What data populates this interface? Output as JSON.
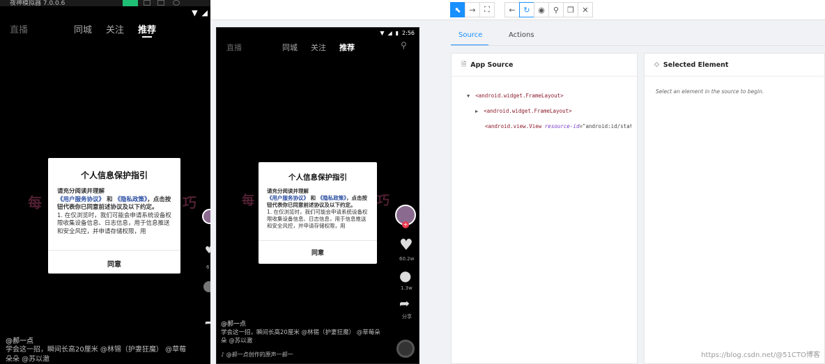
{
  "emulator_left": {
    "title": "夜神模拟器 7.0.0.6",
    "status_icons": [
      "wifi-icon",
      "signal-icon"
    ],
    "nav": {
      "logo": "直播",
      "tab_local": "同城",
      "tab_follow": "关注",
      "tab_recommend": "推荐"
    },
    "dialog": {
      "title": "个人信息保护指引",
      "line1": "请充分阅读并理解",
      "user_agreement": "《用户服务协议》",
      "and": " 和 ",
      "privacy_policy": "《隐私政策》",
      "rest1": "，点击按钮代表你已同意前述协议及以下约定。",
      "point1": "1. 在仅浏览时，我们可能会申请系统设备权限收集设备信息、日志信息，用于信息推送和安全风控，并申请存储权限，用",
      "agree": "同意"
    },
    "side_count": "6",
    "bottom": {
      "user": "@郝一点",
      "desc": "学会这一招，瞬间长高20厘米 @林锡（护妻狂魔） @草莓朵朵 @苏以澈"
    }
  },
  "inspector": {
    "toolbar": {
      "buttons": [
        "select-element",
        "swipe",
        "tap-by-coordinates",
        "back",
        "refresh",
        "show-hide-attributes",
        "search",
        "copy-xml",
        "quit"
      ]
    },
    "device": {
      "time": "2:56",
      "nav": {
        "logo": "直播",
        "tab_local": "同城",
        "tab_follow": "关注",
        "tab_recommend": "推荐"
      },
      "dialog": {
        "title": "个人信息保护指引",
        "line1": "请充分阅读并理解",
        "user_agreement": "《用户服务协议》",
        "and": " 和 ",
        "privacy_policy": "《隐私政策》",
        "rest1": "，点击按钮代表你已同意前述协议及以下约定。",
        "point1": "1. 在仅浏览时，我们可能会申请系统设备权限收集设备信息、日志信息，用于信息推送和安全风控，并申请存储权限，用",
        "agree": "同意"
      },
      "likes": "60.2w",
      "comments": "1.3w",
      "share": "分享",
      "bottom": {
        "user": "@郝一点",
        "desc": "学会这一招，瞬间长高20厘米 @林锡（护妻狂魔） @草莓朵朵 @苏以澈",
        "music": "@郝一点创作的原声一郝一"
      }
    },
    "tabs": {
      "source": "Source",
      "actions": "Actions"
    },
    "app_source": {
      "header": "App Source",
      "tree": [
        {
          "arrow": "▼",
          "tag": "<android.widget.FrameLayout>"
        },
        {
          "arrow": "▶",
          "tag": "<android.widget.FrameLayout>"
        },
        {
          "arrow": "",
          "tag": "<android.view.View",
          "attr": "resource-id",
          "val": "\"android:id/statusBarBac"
        }
      ]
    },
    "selected_element": {
      "header": "Selected Element",
      "hint": "Select an element in the source to begin."
    },
    "watermark": "https://blog.csdn.net/@51CTO博客"
  },
  "colors": {
    "accent": "#1890ff",
    "tag": "#8b1a2b",
    "attr": "#7a3ec9",
    "link": "#2b4ea2"
  }
}
